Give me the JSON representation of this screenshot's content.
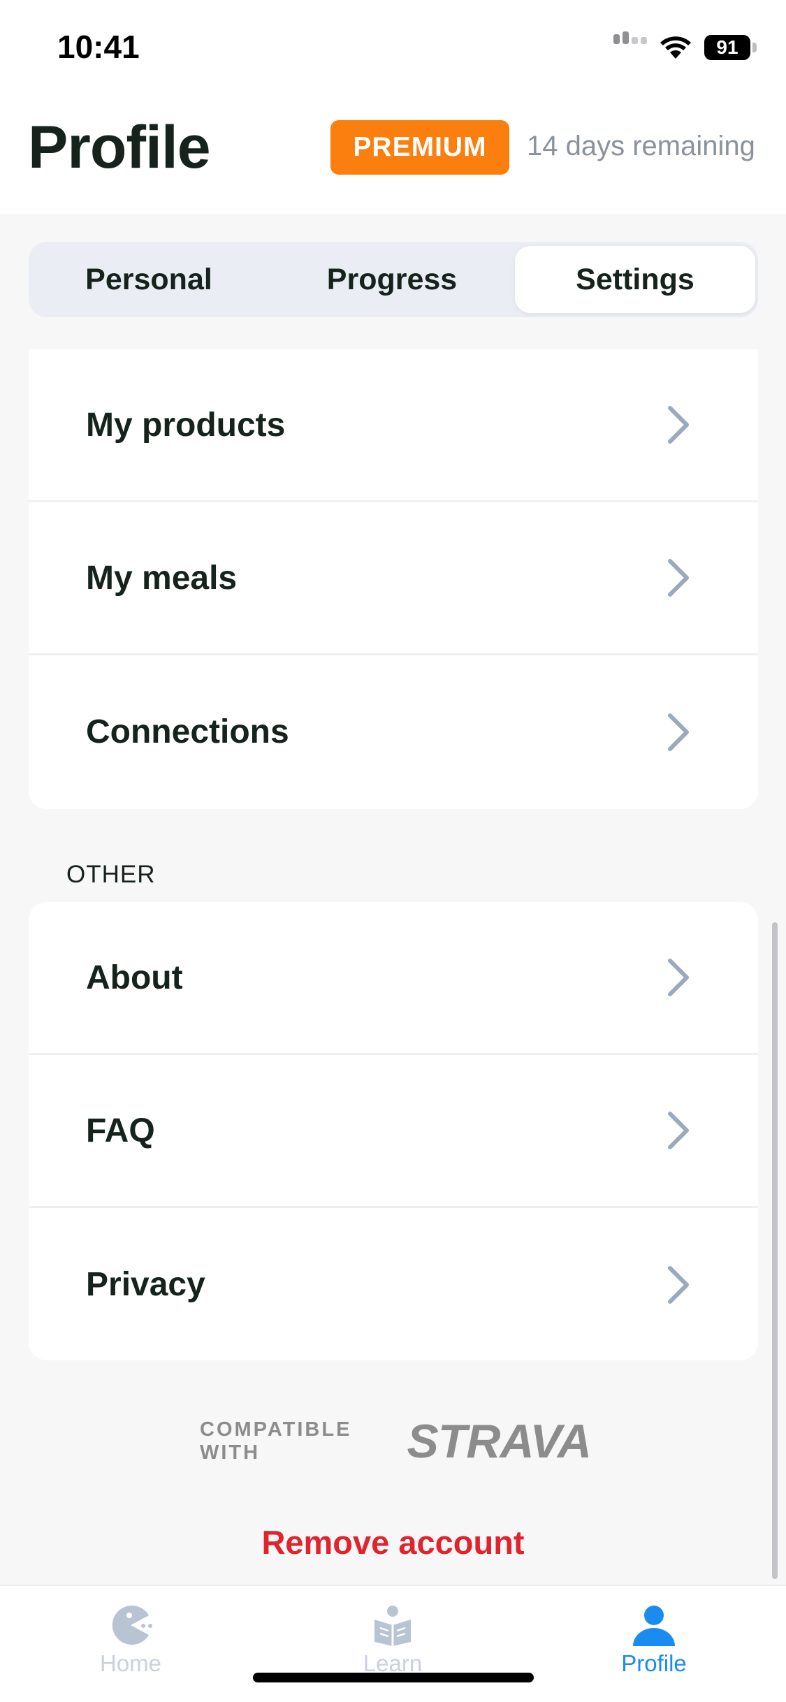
{
  "status_bar": {
    "time": "10:41",
    "battery": "91"
  },
  "header": {
    "title": "Profile",
    "badge": "PREMIUM",
    "subtitle": "14 days remaining"
  },
  "tabs": [
    {
      "label": "Personal",
      "active": false
    },
    {
      "label": "Progress",
      "active": false
    },
    {
      "label": "Settings",
      "active": true
    }
  ],
  "settings_group": {
    "items": [
      {
        "label": "My products"
      },
      {
        "label": "My meals"
      },
      {
        "label": "Connections"
      }
    ]
  },
  "other_group": {
    "title": "OTHER",
    "items": [
      {
        "label": "About"
      },
      {
        "label": "FAQ"
      },
      {
        "label": "Privacy"
      }
    ]
  },
  "footer": {
    "compatible_text": "COMPATIBLE WITH",
    "partner": "STRAVA",
    "remove_account": "Remove account"
  },
  "tabbar": [
    {
      "label": "Home",
      "icon": "home-pacman-icon",
      "active": false
    },
    {
      "label": "Learn",
      "icon": "learn-book-icon",
      "active": false
    },
    {
      "label": "Profile",
      "icon": "profile-person-icon",
      "active": true
    }
  ],
  "colors": {
    "accent": "#1a8cf0",
    "premium": "#fb7f0f",
    "danger": "#e0232c",
    "chevron": "#9aa9bd",
    "inactive_nav": "#b9c4d3"
  }
}
